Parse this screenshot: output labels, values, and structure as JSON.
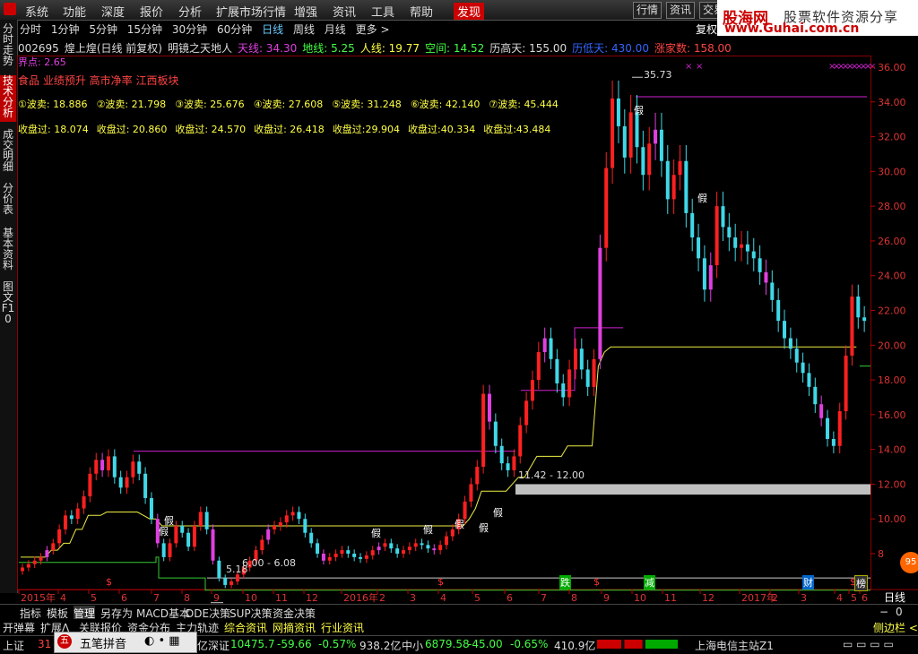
{
  "menu": [
    "系统",
    "功能",
    "深度",
    "报价",
    "分析",
    "扩展市场行情",
    "增强",
    "资讯",
    "工具",
    "帮助",
    "发现"
  ],
  "menu_right": [
    "行情",
    "资讯",
    "交易"
  ],
  "brand": {
    "name": "股海网",
    "slogan": "股票软件资源分享",
    "url": "www.Guhai.com.cn"
  },
  "sidebar": [
    "分时走势",
    "技术分析",
    "成交明细",
    "分价表",
    "基本资料",
    "图文F10"
  ],
  "periods": [
    "分时",
    "1分钟",
    "5分钟",
    "15分钟",
    "30分钟",
    "60分钟",
    "日线",
    "周线",
    "月线",
    "更多 >"
  ],
  "fuquan": "复权",
  "stock_line": {
    "code": "002695",
    "name": "煌上煌(日线 前复权)",
    "indicator": "明镜之天地人",
    "tian": "天线: 34.30",
    "di": "地线: 5.25",
    "ren": "人线: 19.77",
    "kongjian": "空间: 14.52",
    "lgt": "历高天: 155.00",
    "ldt": "历低天: 430.00",
    "zt": "涨家数: 158.00"
  },
  "jiedian": "界点: 2.65",
  "tags": "食品 业绩预升 高市净率 江西板块",
  "bomai": [
    "①波卖: 18.886",
    "②波卖: 21.798",
    "③波卖: 25.676",
    "④波卖: 27.608",
    "⑤波卖: 31.248",
    "⑥波卖: 42.140",
    "⑦波卖: 45.444"
  ],
  "shoupan": [
    "收盘过: 18.074",
    "收盘过: 20.860",
    "收盘过: 24.570",
    "收盘过: 26.418",
    "收盘过:29.904",
    "收盘过:40.334",
    "收盘过:43.484"
  ],
  "annotations": {
    "high": "35.73",
    "low": "5.18",
    "zone1": "6.00 - 6.08",
    "zone2": "11.42 - 12.00"
  },
  "signals": [
    "假",
    "假",
    "假",
    "假",
    "假",
    "假",
    "假",
    "假",
    "假"
  ],
  "bottom_markers": [
    "$",
    "$",
    "$",
    "$",
    "跌",
    "减",
    "财",
    "榜"
  ],
  "period_label": "日线",
  "bottom_tabs": [
    "指标",
    "模板",
    "管理",
    "另存为",
    "MACD基本",
    "DDE决策",
    "SUP决策",
    "资金决策"
  ],
  "tabs2": [
    "开弹幕",
    "扩展Λ",
    "关联报价",
    "资金分布",
    "主力轨迹",
    "综合资讯",
    "网摘资讯",
    "行业资讯",
    "侧边栏 <"
  ],
  "statusbar": {
    "sh_label": "上证",
    "sh_val": "31",
    "sz_label": "深证",
    "sz_val": "10475.7",
    "sz_chg": "-59.66",
    "sz_pct": "-0.57%",
    "sz_amt": "938.2亿",
    "zx_label": "中小",
    "zx_val": "6879.58",
    "zx_chg": "-45.00",
    "zx_pct": "-0.65%",
    "zx_amt": "410.9亿",
    "yi": "亿",
    "server": "上海电信主站Z1"
  },
  "ime": "五笔拼音",
  "badge": "95",
  "chart_data": {
    "type": "candlestick",
    "y_ticks": [
      "36.00",
      "34.00",
      "32.00",
      "30.00",
      "28.00",
      "26.00",
      "24.00",
      "22.00",
      "20.00",
      "18.00",
      "16.00",
      "14.00",
      "12.00",
      "10.00",
      "8"
    ],
    "x_ticks": [
      "2015年",
      "4",
      "5",
      "6",
      "7",
      "8",
      "9",
      "10",
      "11",
      "12",
      "2016年",
      "2",
      "3",
      "4",
      "5",
      "6",
      "7",
      "8",
      "9",
      "10",
      "11",
      "12",
      "2017年",
      "2",
      "3",
      "4",
      "5",
      "6"
    ],
    "ylim": [
      6.5,
      36.5
    ],
    "close": [
      7.2,
      7.4,
      7.6,
      7.8,
      8.2,
      8.6,
      9.4,
      10.2,
      10.0,
      10.6,
      11.3,
      12.6,
      13.4,
      12.8,
      13.6,
      12.4,
      11.8,
      12.4,
      13.3,
      12.6,
      11.2,
      10.0,
      8.6,
      7.8,
      8.6,
      9.6,
      9.2,
      8.4,
      9.6,
      10.4,
      9.4,
      7.6,
      6.6,
      6.2,
      6.4,
      6.8,
      7.2,
      7.6,
      8.2,
      8.8,
      9.4,
      9.6,
      9.8,
      10.2,
      10.4,
      10.0,
      9.2,
      8.6,
      8.0,
      7.6,
      7.8,
      8.0,
      8.2,
      8.0,
      7.8,
      7.7,
      7.9,
      8.2,
      8.4,
      8.6,
      8.3,
      8.0,
      8.2,
      8.4,
      8.6,
      8.5,
      8.3,
      8.2,
      8.5,
      9.0,
      9.4,
      10.0,
      11.0,
      12.0,
      13.0,
      17.2,
      15.6,
      14.2,
      13.2,
      12.8,
      13.6,
      15.4,
      16.8,
      18.0,
      19.6,
      20.4,
      19.2,
      17.8,
      17.0,
      18.6,
      19.8,
      18.6,
      17.6,
      19.2,
      25.6,
      30.2,
      34.2,
      32.6,
      30.8,
      33.4,
      31.4,
      29.8,
      31.6,
      32.4,
      30.6,
      28.4,
      29.8,
      30.6,
      27.6,
      26.2,
      25.0,
      23.2,
      24.6,
      28.0,
      26.8,
      26.2,
      25.6,
      25.8,
      25.4,
      25.0,
      24.2,
      23.6,
      22.6,
      21.4,
      20.4,
      19.8,
      19.0,
      18.4,
      17.6,
      16.6,
      15.8,
      14.6,
      14.2,
      16.2,
      19.4,
      22.8,
      21.6,
      21.4
    ],
    "support": [
      7.8,
      7.8,
      7.8,
      7.8,
      7.8,
      8.2,
      8.2,
      8.6,
      8.6,
      9.4,
      9.4,
      10.2,
      10.2,
      10.2,
      10.4,
      10.4,
      10.4,
      10.4,
      10.4,
      10.4,
      10.2,
      10.0,
      10.0,
      9.6,
      9.6,
      9.6,
      9.6,
      9.6,
      9.6,
      9.6,
      9.6,
      9.6,
      9.6,
      9.6,
      9.6,
      9.6,
      9.6,
      9.6,
      9.6,
      9.6,
      9.6,
      9.6,
      9.6,
      9.6,
      9.6,
      9.6,
      9.6,
      9.6,
      9.6,
      9.6,
      9.6,
      9.6,
      9.6,
      9.6,
      9.6,
      9.6,
      9.6,
      9.6,
      9.6,
      9.6,
      9.6,
      9.6,
      9.6,
      9.6,
      9.6,
      9.6,
      9.6,
      9.6,
      9.6,
      9.6,
      9.6,
      9.6,
      9.6,
      10.0,
      10.6,
      11.6,
      11.6,
      11.6,
      11.6,
      11.6,
      12.0,
      12.4,
      12.4,
      13.0,
      13.6,
      13.6,
      13.6,
      13.6,
      13.6,
      14.2,
      14.2,
      14.2,
      14.2,
      14.2,
      18.8,
      19.6,
      19.9,
      19.9,
      19.9,
      19.9,
      19.9,
      19.9,
      19.9,
      19.9,
      19.9,
      19.9,
      19.9,
      19.9,
      19.9,
      19.9,
      19.9,
      19.9,
      19.9,
      19.9,
      19.9,
      19.9,
      19.9,
      19.9,
      19.9,
      19.9,
      19.9,
      19.9,
      19.9,
      19.9,
      19.9,
      19.9,
      19.9,
      19.9,
      19.9,
      19.9,
      19.9,
      19.9,
      19.9,
      19.9,
      19.9,
      19.9,
      19.9
    ],
    "resist_levels": [
      34.3,
      21.0,
      17.4,
      13.9
    ],
    "ground_levels": [
      7.5,
      6.6,
      5.9
    ],
    "band": [
      11.4,
      12.0
    ]
  }
}
